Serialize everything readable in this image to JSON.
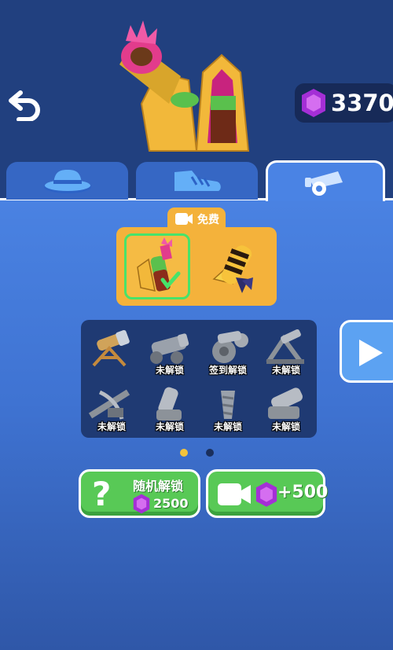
{
  "header": {
    "gem_count": "3370",
    "back_icon": "back-arrow-icon",
    "gem_icon": "purple-gem-icon"
  },
  "tabs": [
    {
      "icon": "hat-icon",
      "active": false
    },
    {
      "icon": "shoe-icon",
      "active": false
    },
    {
      "icon": "cannon-icon",
      "active": true
    }
  ],
  "skins": {
    "free_label": "免费",
    "free_icon": "video-camera-icon",
    "items": [
      {
        "icon": "pink-cannon-skin-icon",
        "selected": true
      },
      {
        "icon": "bee-cannon-skin-icon",
        "selected": false
      }
    ]
  },
  "cannon_grid": {
    "items": [
      {
        "icon": "telescope-cannon-icon",
        "label": ""
      },
      {
        "icon": "gatling-cannon-icon",
        "label": "未解锁"
      },
      {
        "icon": "gear-cannon-icon",
        "label": "签到解锁"
      },
      {
        "icon": "catapult-icon",
        "label": "未解锁"
      },
      {
        "icon": "crossbow-icon",
        "label": "未解锁"
      },
      {
        "icon": "mortar-icon",
        "label": "未解锁"
      },
      {
        "icon": "drill-cannon-icon",
        "label": "未解锁"
      },
      {
        "icon": "heavy-cannon-icon",
        "label": "未解锁"
      }
    ],
    "next_icon": "play-arrow-icon"
  },
  "pagination": {
    "current": 1,
    "total": 2
  },
  "actions": {
    "random_unlock": {
      "label": "随机解锁",
      "cost": "2500",
      "icon": "question-mark-icon"
    },
    "watch_ad": {
      "reward": "+500",
      "icon": "video-camera-icon"
    }
  },
  "colors": {
    "accent_green": "#58c956",
    "gem_purple": "#a42fd6",
    "gold": "#f4b23b",
    "panel_dark": "#1f3a73"
  }
}
